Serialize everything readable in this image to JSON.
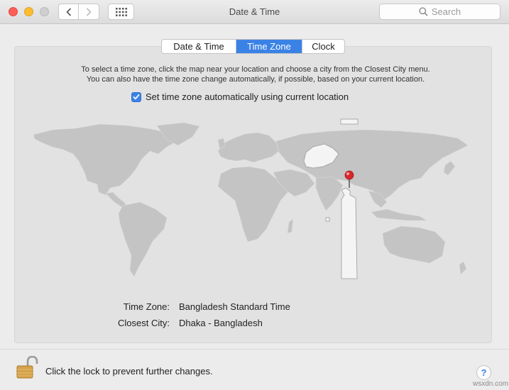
{
  "window": {
    "title": "Date & Time",
    "search_placeholder": "Search"
  },
  "tabs": [
    {
      "label": "Date & Time",
      "selected": false
    },
    {
      "label": "Time Zone",
      "selected": true
    },
    {
      "label": "Clock",
      "selected": false
    }
  ],
  "instructions": {
    "line1": "To select a time zone, click the map near your location and choose a city from the Closest City menu.",
    "line2": "You can also have the time zone change automatically, if possible, based on your current location."
  },
  "auto_timezone": {
    "label": "Set time zone automatically using current location",
    "checked": true
  },
  "fields": {
    "timezone_label": "Time Zone:",
    "timezone_value": "Bangladesh Standard Time",
    "city_label": "Closest City:",
    "city_value": "Dhaka - Bangladesh"
  },
  "footer": {
    "lock_text": "Click the lock to prevent further changes.",
    "help_label": "?"
  },
  "watermark": "wsxdn.com",
  "colors": {
    "accent": "#3b82e6",
    "pin": "#d8262b"
  }
}
